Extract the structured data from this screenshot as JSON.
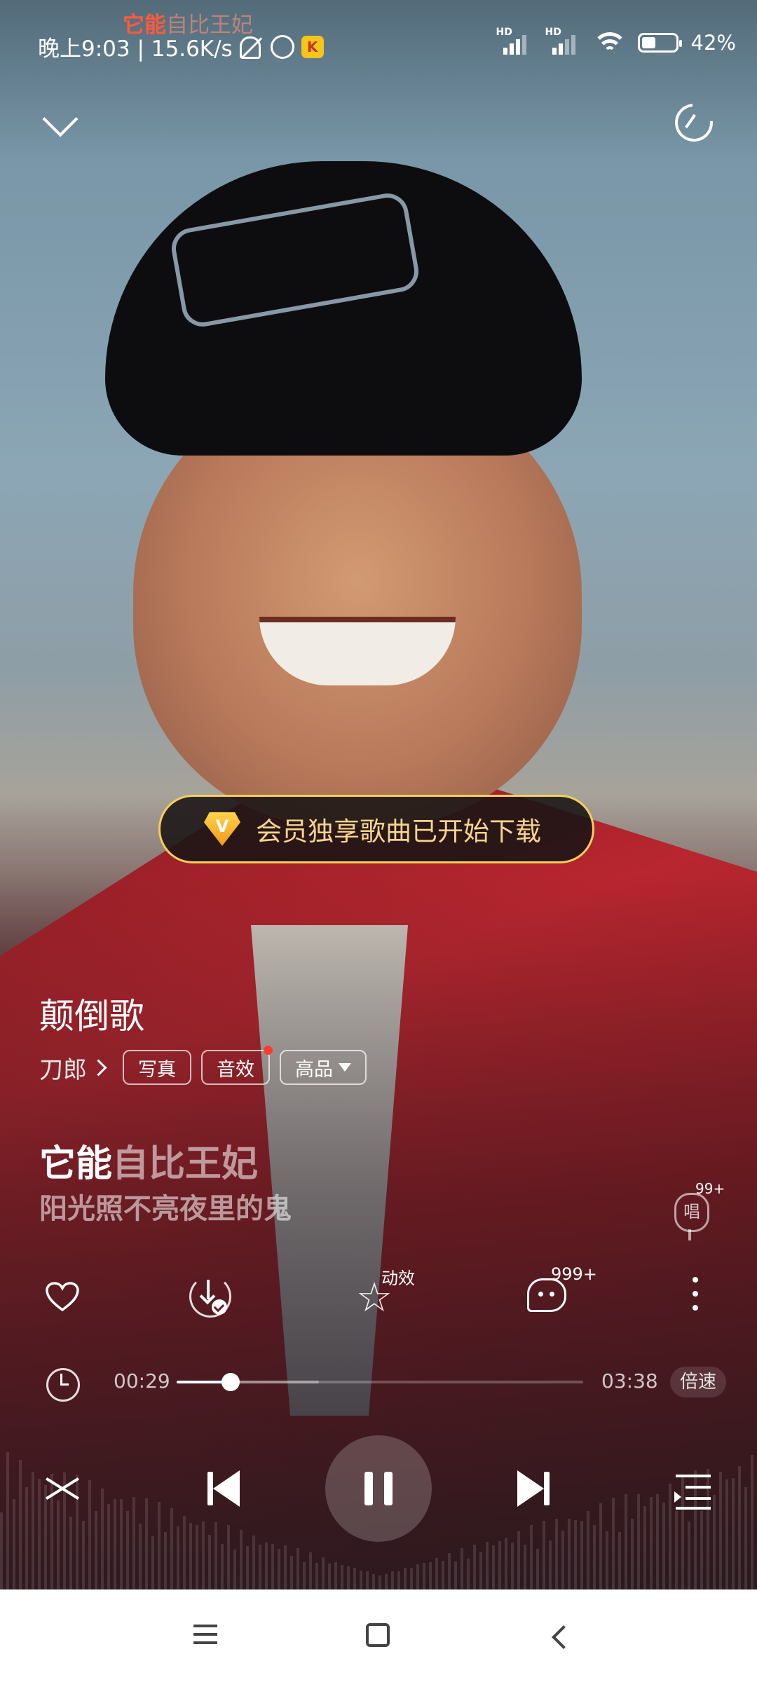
{
  "status_bar": {
    "time_speed": "晚上9:03 | 15.6K/s",
    "marquee_highlight": "它能",
    "marquee_rest": "自比王妃",
    "signal_1_label": "HD",
    "signal_2_label": "HD",
    "app_badge": "K",
    "battery_level": 0.42,
    "battery_pct": "42%"
  },
  "toast": {
    "icon_letter": "V",
    "text": "会员独享歌曲已开始下载",
    "border_color": "#f4cf57",
    "text_color": "#f6d58c"
  },
  "song": {
    "title": "颠倒歌",
    "artist": "刀郎",
    "tags": [
      {
        "label": "写真"
      },
      {
        "label": "音效",
        "has_dot": true
      },
      {
        "label": "高品",
        "has_dropdown": true
      }
    ]
  },
  "lyrics": {
    "current_sung": "它能",
    "current_unsung": "自比王妃",
    "next": "阳光照不亮夜里的鬼"
  },
  "sing": {
    "label": "唱",
    "badge": "99+"
  },
  "actions": {
    "like_icon": "heart-icon",
    "download_icon": "download-done-icon",
    "effect_badge": "动效",
    "comment_badge": "999+"
  },
  "progress": {
    "current": "00:29",
    "total": "03:38",
    "played_fraction": 0.133,
    "speed_label": "倍速"
  },
  "transport": {
    "state": "playing"
  },
  "navbar": {
    "buttons": [
      "menu",
      "home",
      "back"
    ]
  }
}
